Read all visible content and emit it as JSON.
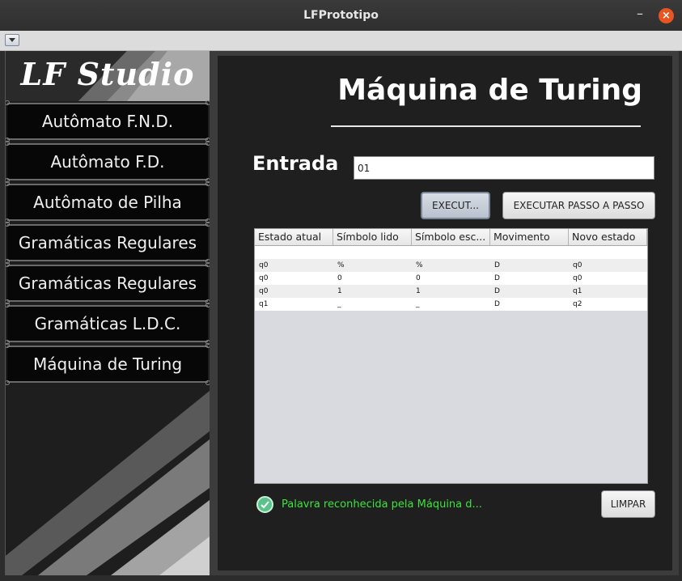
{
  "window": {
    "title": "LFPrototipo"
  },
  "sidebar": {
    "logo": "LF Studio",
    "items": [
      {
        "label": "Autômato F.N.D."
      },
      {
        "label": "Autômato F.D."
      },
      {
        "label": "Autômato de Pilha"
      },
      {
        "label": "Gramáticas Regulares"
      },
      {
        "label": "Gramáticas Regulares"
      },
      {
        "label": "Gramáticas L.D.C."
      },
      {
        "label": "Máquina de Turing"
      }
    ]
  },
  "main": {
    "title": "Máquina de Turing",
    "input_label": "Entrada",
    "input_value": "01",
    "execute_button": "EXECUT...",
    "step_button": "EXECUTAR PASSO A PASSO",
    "clear_button": "LIMPAR",
    "table": {
      "headers": [
        "Estado atual",
        "Símbolo lido",
        "Símbolo esc...",
        "Movimento",
        "Novo estado"
      ],
      "rows": [
        [
          "",
          "",
          "",
          "",
          ""
        ],
        [
          "q0",
          "%",
          "%",
          "D",
          "q0"
        ],
        [
          "q0",
          "0",
          "0",
          "D",
          "q0"
        ],
        [
          "q0",
          "1",
          "1",
          "D",
          "q1"
        ],
        [
          "q1",
          "_",
          "_",
          "D",
          "q2"
        ]
      ]
    },
    "status": {
      "icon": "check-circle-icon",
      "text": "Palavra reconhecida pela Máquina d...",
      "color": "#3ee23e"
    }
  }
}
